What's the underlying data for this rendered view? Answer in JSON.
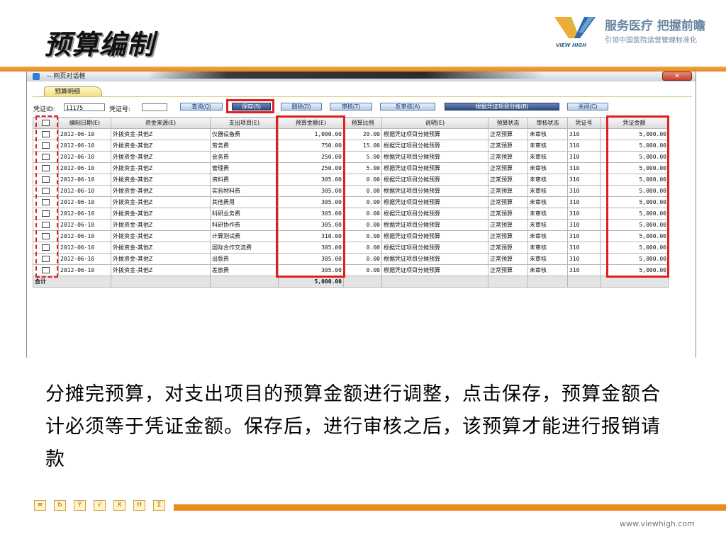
{
  "slide": {
    "title": "预算编制",
    "brand_slogan": "服务医疗  把握前瞻",
    "brand_subtitle": "引领中国医院运营管理标准化",
    "logo_text": "VIEW HIGH",
    "body_text": "分摊完预算，对支出项目的预算金额进行调整，点击保存，预算金额合计必须等于凭证金额。保存后，进行审核之后，该预算才能进行报销请款",
    "url": "www.viewhigh.com"
  },
  "dialog": {
    "title": "-- 网页对话框",
    "close_label": "✕",
    "tab_label": "预算明细",
    "voucher_id_label": "凭证ID:",
    "voucher_id_value": "11175",
    "voucher_no_label": "凭证号:",
    "voucher_no_value": ""
  },
  "toolbar": {
    "query": "查询(Q)",
    "save": "保存(S)",
    "delete": "删除(D)",
    "audit": "审核(T)",
    "unaudit": "反审核(A)",
    "allocate": "根据凭证项目分摊(B)",
    "close": "关闭(C)"
  },
  "grid": {
    "headers": [
      "",
      "编制日期(E)",
      "资金来源(E)",
      "支出项目(E)",
      "预算金额(E)",
      "预算比例",
      "说明(E)",
      "预算状态",
      "审核状态",
      "凭证号",
      "凭证金额"
    ],
    "rows": [
      [
        "",
        "2012-06-10",
        "外拨资金-其他Z",
        "仪器设备费",
        "1,000.00",
        "20.00",
        "根据凭证项目分摊预算",
        "正常预算",
        "未审核",
        "310",
        "5,000.00"
      ],
      [
        "",
        "2012-06-10",
        "外拨资金-其他Z",
        "劳务费",
        "750.00",
        "15.00",
        "根据凭证项目分摊预算",
        "正常预算",
        "未审核",
        "310",
        "5,000.00"
      ],
      [
        "",
        "2012-06-10",
        "外拨资金-其他Z",
        "会务费",
        "250.00",
        "5.00",
        "根据凭证项目分摊预算",
        "正常预算",
        "未审核",
        "310",
        "5,000.00"
      ],
      [
        "",
        "2012-06-10",
        "外拨资金-其他Z",
        "管理费",
        "250.00",
        "5.00",
        "根据凭证项目分摊预算",
        "正常预算",
        "未审核",
        "310",
        "5,000.00"
      ],
      [
        "",
        "2012-06-10",
        "外拨资金-其他Z",
        "资料费",
        "305.00",
        "0.00",
        "根据凭证项目分摊预算",
        "正常预算",
        "未审核",
        "310",
        "5,000.00"
      ],
      [
        "",
        "2012-06-10",
        "外拨资金-其他Z",
        "实验材料费",
        "305.00",
        "0.00",
        "根据凭证项目分摊预算",
        "正常预算",
        "未审核",
        "310",
        "5,000.00"
      ],
      [
        "",
        "2012-06-10",
        "外拨资金-其他Z",
        "其他费用",
        "305.00",
        "0.00",
        "根据凭证项目分摊预算",
        "正常预算",
        "未审核",
        "310",
        "5,000.00"
      ],
      [
        "",
        "2012-06-10",
        "外拨资金-其他Z",
        "科研业务费",
        "305.00",
        "0.00",
        "根据凭证项目分摊预算",
        "正常预算",
        "未审核",
        "310",
        "5,000.00"
      ],
      [
        "",
        "2012-06-10",
        "外拨资金-其他Z",
        "科研协作费",
        "305.00",
        "0.00",
        "根据凭证项目分摊预算",
        "正常预算",
        "未审核",
        "310",
        "5,000.00"
      ],
      [
        "",
        "2012-06-10",
        "外拨资金-其他Z",
        "计算测试费",
        "310.00",
        "0.00",
        "根据凭证项目分摊预算",
        "正常预算",
        "未审核",
        "310",
        "5,000.00"
      ],
      [
        "",
        "2012-06-10",
        "外拨资金-其他Z",
        "国际合作交流费",
        "305.00",
        "0.00",
        "根据凭证项目分摊预算",
        "正常预算",
        "未审核",
        "310",
        "5,000.00"
      ],
      [
        "",
        "2012-06-10",
        "外拨资金-其他Z",
        "出版费",
        "305.00",
        "0.00",
        "根据凭证项目分摊预算",
        "正常预算",
        "未审核",
        "310",
        "5,000.00"
      ],
      [
        "",
        "2012-06-10",
        "外拨资金-其他Z",
        "差旅费",
        "305.00",
        "0.00",
        "根据凭证项目分摊预算",
        "正常预算",
        "未审核",
        "310",
        "5,000.00"
      ]
    ],
    "total_label": "合计",
    "total_amount": "5,000.00"
  },
  "bottom_icons": [
    "office-icon-1",
    "office-icon-2",
    "office-icon-3",
    "office-icon-4",
    "office-icon-5",
    "office-icon-6",
    "office-icon-7"
  ],
  "colors": {
    "accent_orange": "#ed8a1e",
    "highlight_red": "#e02020",
    "brand_blue": "#6b86a2"
  }
}
